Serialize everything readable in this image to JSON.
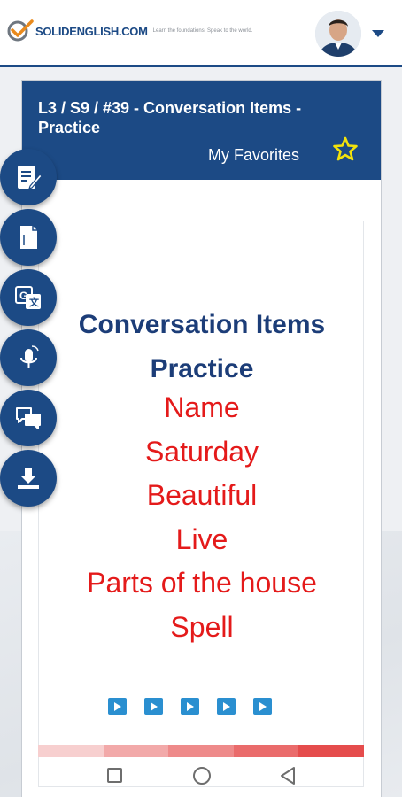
{
  "header": {
    "logo_text": "SOLIDENGLISH.COM",
    "tagline": "Learn the foundations. Speak to the world."
  },
  "lesson": {
    "title": "L3 / S9 / #39 - Conversation Items - Practice",
    "favorites_label": "My Favorites",
    "heading_line1": "Conversation Items",
    "heading_line2": "Practice",
    "items": [
      "Name",
      "Saturday",
      "Beautiful",
      "Live",
      "Parts of the house",
      "Spell"
    ]
  },
  "side_tools": [
    {
      "icon": "notes-edit-icon"
    },
    {
      "icon": "document-icon"
    },
    {
      "icon": "translate-icon"
    },
    {
      "icon": "microphone-icon"
    },
    {
      "icon": "chat-icon"
    },
    {
      "icon": "download-icon"
    }
  ],
  "audio_buttons": 5,
  "progress_colors": [
    "#f7cfcf",
    "#f2a9a9",
    "#ee8a8a",
    "#ea6b6b",
    "#e54c4c"
  ],
  "colors": {
    "brand_blue": "#1c4a85",
    "heading_blue": "#1c3d78",
    "item_red": "#e41a1a",
    "star_yellow": "#f2e20c",
    "play_blue": "#2a8fd0"
  }
}
